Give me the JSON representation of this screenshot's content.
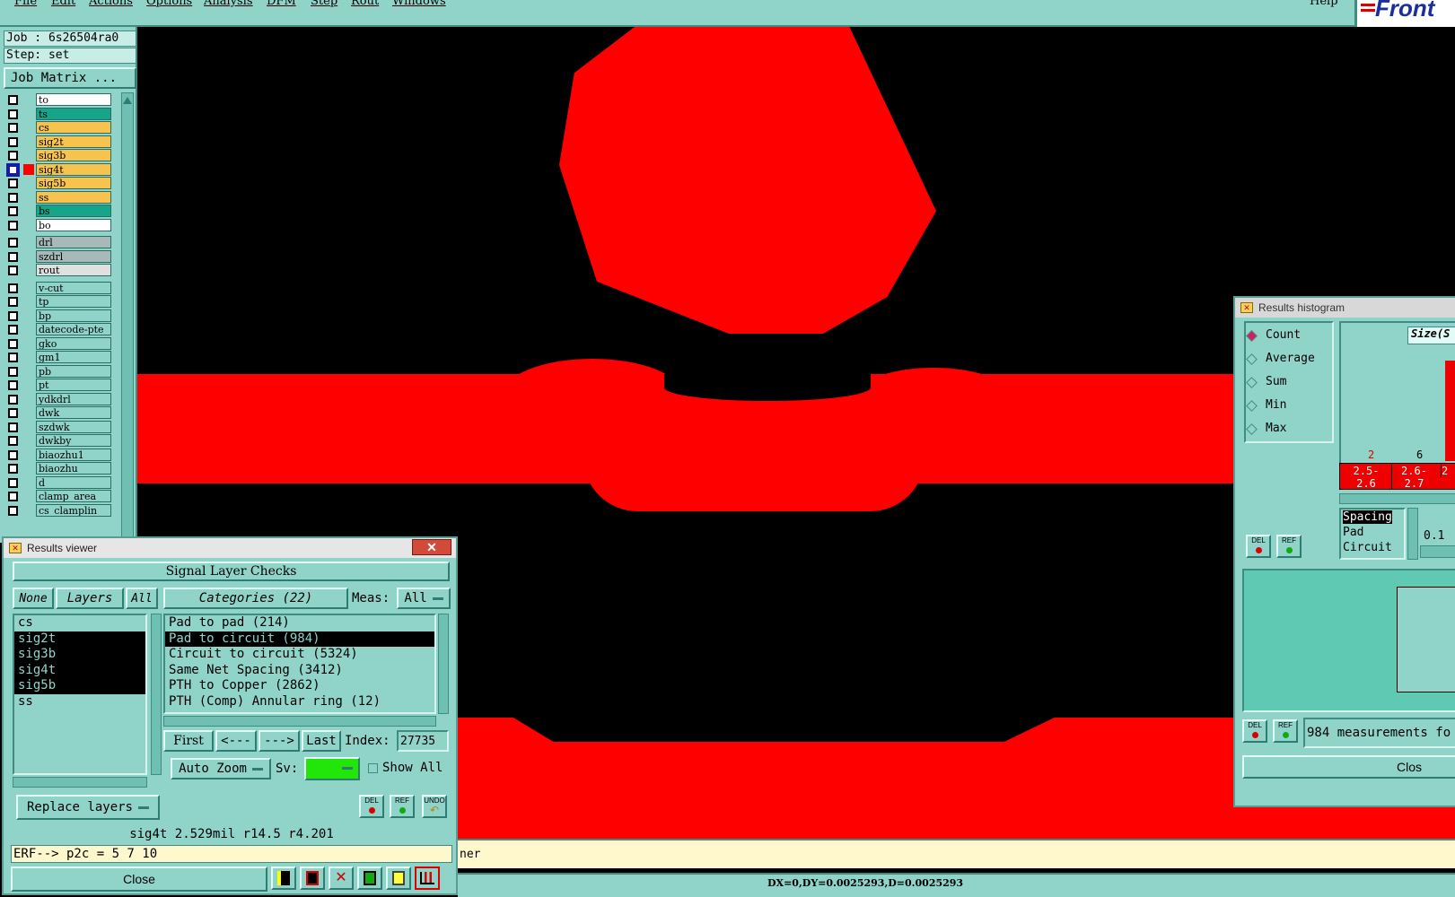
{
  "menubar": {
    "items": [
      "File",
      "Edit",
      "Actions",
      "Options",
      "Analysis",
      "DFM",
      "Step",
      "Rout",
      "Windows"
    ],
    "help": "Help",
    "brand": "Front"
  },
  "job": {
    "job_line": "Job : 6s26504ra0",
    "step_line": "Step: set",
    "matrix_button": "Job Matrix ..."
  },
  "layers": [
    {
      "name": "to",
      "color": "#ffffff"
    },
    {
      "name": "ts",
      "color": "#17a589"
    },
    {
      "name": "cs",
      "color": "#f8c24f"
    },
    {
      "name": "sig2t",
      "color": "#f8c24f"
    },
    {
      "name": "sig3b",
      "color": "#f8c24f"
    },
    {
      "name": "sig4t",
      "color": "#f8c24f"
    },
    {
      "name": "sig5b",
      "color": "#f8c24f"
    },
    {
      "name": "ss",
      "color": "#f8c24f"
    },
    {
      "name": "bs",
      "color": "#17a589"
    },
    {
      "name": "bo",
      "color": "#ffffff"
    },
    {
      "name": "drl",
      "color": "#a7b9b8"
    },
    {
      "name": "szdrl",
      "color": "#a7b9b8"
    },
    {
      "name": "rout",
      "color": "#e0e0e0"
    },
    {
      "name": "v-cut",
      "color": "#8fd3c9"
    },
    {
      "name": "tp",
      "color": "#8fd3c9"
    },
    {
      "name": "bp",
      "color": "#8fd3c9"
    },
    {
      "name": "datecode-pte",
      "color": "#8fd3c9"
    },
    {
      "name": "gko",
      "color": "#8fd3c9"
    },
    {
      "name": "gm1",
      "color": "#8fd3c9"
    },
    {
      "name": "pb",
      "color": "#8fd3c9"
    },
    {
      "name": "pt",
      "color": "#8fd3c9"
    },
    {
      "name": "ydkdrl",
      "color": "#8fd3c9"
    },
    {
      "name": "dwk",
      "color": "#8fd3c9"
    },
    {
      "name": "szdwk",
      "color": "#8fd3c9"
    },
    {
      "name": "dwkby",
      "color": "#8fd3c9"
    },
    {
      "name": "biaozhu1",
      "color": "#8fd3c9"
    },
    {
      "name": "biaozhu",
      "color": "#8fd3c9"
    },
    {
      "name": "d",
      "color": "#8fd3c9"
    },
    {
      "name": "clamp_area",
      "color": "#8fd3c9"
    },
    {
      "name": "cs_clamplin",
      "color": "#8fd3c9"
    }
  ],
  "results_viewer": {
    "title": "Results viewer",
    "header": "Signal Layer Checks",
    "none_label": "None",
    "layers_label": "Layers",
    "all_label": "All",
    "categories_label": "Categories (22)",
    "meas_label": "Meas:",
    "meas_value": "All",
    "layer_items": [
      "cs",
      "sig2t",
      "sig3b",
      "sig4t",
      "sig5b",
      "ss"
    ],
    "category_items": [
      "Pad to pad (214)",
      "Pad to circuit (984)",
      "Circuit to circuit (5324)",
      "Same Net Spacing (3412)",
      "PTH to Copper (2862)",
      "PTH (Comp) Annular ring (12)"
    ],
    "first_label": "First",
    "prev_label": "<---",
    "next_label": "--->",
    "last_label": "Last",
    "index_label": "Index:",
    "index_value": "27735",
    "autozoom_label": "Auto Zoom",
    "sv_label": "Sv:",
    "show_all_label": "Show All",
    "replace_label": "Replace layers",
    "info_line": "sig4t 2.529mil  r14.5  r4.201",
    "erf_line": "ERF--> p2c = 5 7 10",
    "close_label": "Close"
  },
  "histogram": {
    "title": "Results histogram",
    "modes": [
      "Count",
      "Average",
      "Sum",
      "Min",
      "Max"
    ],
    "size_label": "Size(S",
    "bar_counts": [
      "2",
      "6"
    ],
    "bins": [
      "2.5-2.6",
      "2.6-2.7",
      "2"
    ],
    "categories": [
      "Spacing",
      "Pad",
      "Circuit"
    ],
    "value_label": "0.1",
    "measurements": "984 measurements fo",
    "close_label": "Clos"
  },
  "status": {
    "erf_tail": "ner",
    "coords": "DX=0,DY=0.0025293,D=0.0025293"
  },
  "icons": {
    "del": "DEL",
    "ref": "REF",
    "undo": "UNDO"
  }
}
